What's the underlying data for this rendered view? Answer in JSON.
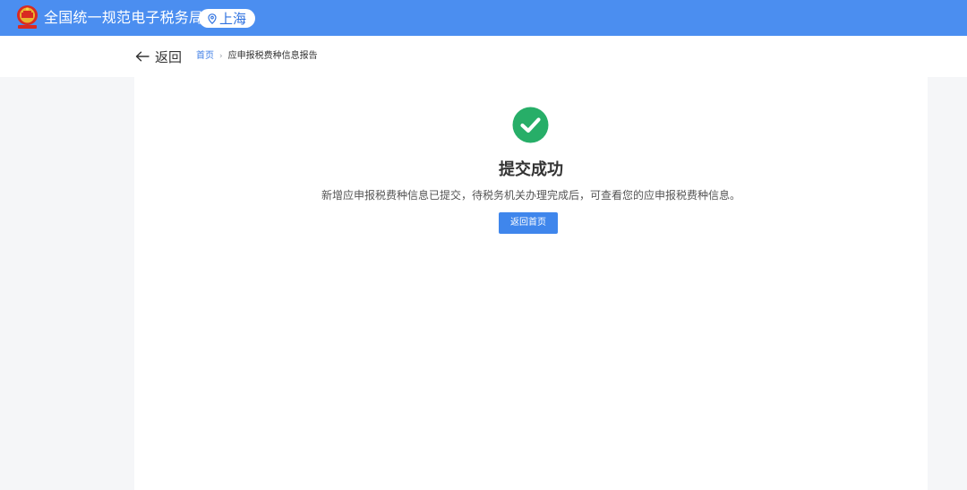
{
  "header": {
    "site_title": "全国统一规范电子税务局",
    "region": "上海",
    "icons": {
      "emblem": "national-emblem-icon",
      "region": "location-pin-icon"
    },
    "colors": {
      "bar": "#4b8ef0",
      "region_text": "#2f72e0"
    }
  },
  "subnav": {
    "back_label": "返回",
    "back_icon": "arrow-left-icon",
    "breadcrumb": {
      "home": "首页",
      "separator": "›",
      "current": "应申报税费种信息报告"
    }
  },
  "result": {
    "icon": "check-circle-icon",
    "title": "提交成功",
    "description": "新增应申报税费种信息已提交，待税务机关办理完成后，可查看您的应申报税费种信息。",
    "home_button_label": "返回首页",
    "colors": {
      "success": "#27ae68",
      "button": "#3f86ec",
      "link": "#3d7de6"
    }
  }
}
